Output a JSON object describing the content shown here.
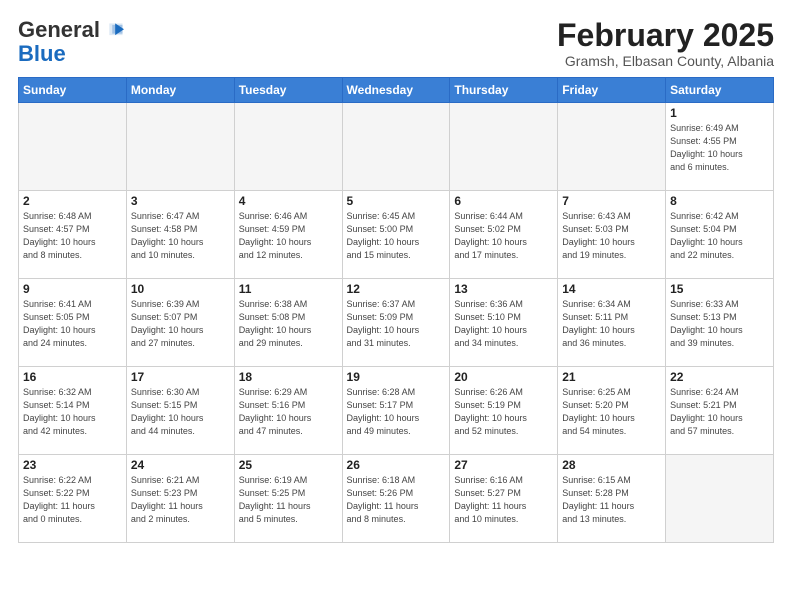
{
  "header": {
    "logo_general": "General",
    "logo_blue": "Blue",
    "month_title": "February 2025",
    "location": "Gramsh, Elbasan County, Albania"
  },
  "weekdays": [
    "Sunday",
    "Monday",
    "Tuesday",
    "Wednesday",
    "Thursday",
    "Friday",
    "Saturday"
  ],
  "weeks": [
    [
      {
        "day": "",
        "info": ""
      },
      {
        "day": "",
        "info": ""
      },
      {
        "day": "",
        "info": ""
      },
      {
        "day": "",
        "info": ""
      },
      {
        "day": "",
        "info": ""
      },
      {
        "day": "",
        "info": ""
      },
      {
        "day": "1",
        "info": "Sunrise: 6:49 AM\nSunset: 4:55 PM\nDaylight: 10 hours\nand 6 minutes."
      }
    ],
    [
      {
        "day": "2",
        "info": "Sunrise: 6:48 AM\nSunset: 4:57 PM\nDaylight: 10 hours\nand 8 minutes."
      },
      {
        "day": "3",
        "info": "Sunrise: 6:47 AM\nSunset: 4:58 PM\nDaylight: 10 hours\nand 10 minutes."
      },
      {
        "day": "4",
        "info": "Sunrise: 6:46 AM\nSunset: 4:59 PM\nDaylight: 10 hours\nand 12 minutes."
      },
      {
        "day": "5",
        "info": "Sunrise: 6:45 AM\nSunset: 5:00 PM\nDaylight: 10 hours\nand 15 minutes."
      },
      {
        "day": "6",
        "info": "Sunrise: 6:44 AM\nSunset: 5:02 PM\nDaylight: 10 hours\nand 17 minutes."
      },
      {
        "day": "7",
        "info": "Sunrise: 6:43 AM\nSunset: 5:03 PM\nDaylight: 10 hours\nand 19 minutes."
      },
      {
        "day": "8",
        "info": "Sunrise: 6:42 AM\nSunset: 5:04 PM\nDaylight: 10 hours\nand 22 minutes."
      }
    ],
    [
      {
        "day": "9",
        "info": "Sunrise: 6:41 AM\nSunset: 5:05 PM\nDaylight: 10 hours\nand 24 minutes."
      },
      {
        "day": "10",
        "info": "Sunrise: 6:39 AM\nSunset: 5:07 PM\nDaylight: 10 hours\nand 27 minutes."
      },
      {
        "day": "11",
        "info": "Sunrise: 6:38 AM\nSunset: 5:08 PM\nDaylight: 10 hours\nand 29 minutes."
      },
      {
        "day": "12",
        "info": "Sunrise: 6:37 AM\nSunset: 5:09 PM\nDaylight: 10 hours\nand 31 minutes."
      },
      {
        "day": "13",
        "info": "Sunrise: 6:36 AM\nSunset: 5:10 PM\nDaylight: 10 hours\nand 34 minutes."
      },
      {
        "day": "14",
        "info": "Sunrise: 6:34 AM\nSunset: 5:11 PM\nDaylight: 10 hours\nand 36 minutes."
      },
      {
        "day": "15",
        "info": "Sunrise: 6:33 AM\nSunset: 5:13 PM\nDaylight: 10 hours\nand 39 minutes."
      }
    ],
    [
      {
        "day": "16",
        "info": "Sunrise: 6:32 AM\nSunset: 5:14 PM\nDaylight: 10 hours\nand 42 minutes."
      },
      {
        "day": "17",
        "info": "Sunrise: 6:30 AM\nSunset: 5:15 PM\nDaylight: 10 hours\nand 44 minutes."
      },
      {
        "day": "18",
        "info": "Sunrise: 6:29 AM\nSunset: 5:16 PM\nDaylight: 10 hours\nand 47 minutes."
      },
      {
        "day": "19",
        "info": "Sunrise: 6:28 AM\nSunset: 5:17 PM\nDaylight: 10 hours\nand 49 minutes."
      },
      {
        "day": "20",
        "info": "Sunrise: 6:26 AM\nSunset: 5:19 PM\nDaylight: 10 hours\nand 52 minutes."
      },
      {
        "day": "21",
        "info": "Sunrise: 6:25 AM\nSunset: 5:20 PM\nDaylight: 10 hours\nand 54 minutes."
      },
      {
        "day": "22",
        "info": "Sunrise: 6:24 AM\nSunset: 5:21 PM\nDaylight: 10 hours\nand 57 minutes."
      }
    ],
    [
      {
        "day": "23",
        "info": "Sunrise: 6:22 AM\nSunset: 5:22 PM\nDaylight: 11 hours\nand 0 minutes."
      },
      {
        "day": "24",
        "info": "Sunrise: 6:21 AM\nSunset: 5:23 PM\nDaylight: 11 hours\nand 2 minutes."
      },
      {
        "day": "25",
        "info": "Sunrise: 6:19 AM\nSunset: 5:25 PM\nDaylight: 11 hours\nand 5 minutes."
      },
      {
        "day": "26",
        "info": "Sunrise: 6:18 AM\nSunset: 5:26 PM\nDaylight: 11 hours\nand 8 minutes."
      },
      {
        "day": "27",
        "info": "Sunrise: 6:16 AM\nSunset: 5:27 PM\nDaylight: 11 hours\nand 10 minutes."
      },
      {
        "day": "28",
        "info": "Sunrise: 6:15 AM\nSunset: 5:28 PM\nDaylight: 11 hours\nand 13 minutes."
      },
      {
        "day": "",
        "info": ""
      }
    ]
  ]
}
